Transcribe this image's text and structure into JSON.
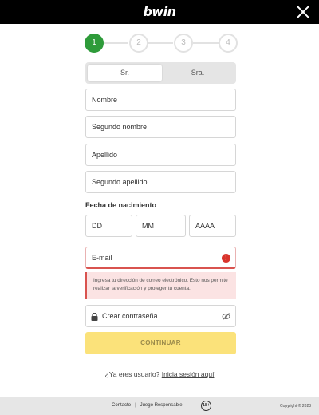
{
  "header": {
    "logo": "bwin"
  },
  "stepper": {
    "steps": [
      "1",
      "2",
      "3",
      "4"
    ],
    "active_step": 1
  },
  "title_toggle": {
    "options": [
      "Sr.",
      "Sra."
    ],
    "selected": "Sr."
  },
  "form": {
    "first_name_placeholder": "Nombre",
    "middle_name_placeholder": "Segundo nombre",
    "last_name_placeholder": "Apellido",
    "second_last_name_placeholder": "Segundo apellido",
    "birthdate_label": "Fecha de nacimiento",
    "day_placeholder": "DD",
    "month_placeholder": "MM",
    "year_placeholder": "AAAA",
    "email_placeholder": "E-mail",
    "email_error_icon": "!",
    "email_error": "Ingresa tu dirección de correo electrónico. Esto nos permite realizar la verificación y proteger tu cuenta.",
    "password_placeholder": "Crear contraseña"
  },
  "actions": {
    "continue_label": "CONTINUAR",
    "already_user_text": "¿Ya eres usuario?",
    "login_link": "Inicia sesión aquí"
  },
  "footer": {
    "contact": "Contacto",
    "separator": "|",
    "responsible": "Juego Responsable",
    "age_badge": "18+",
    "copyright": "Copyright © 2023"
  },
  "colors": {
    "accent_green": "#2e9b3a",
    "button_yellow": "#fbe27a",
    "error_red": "#d9534f"
  },
  "icons": [
    "close-icon",
    "error-icon",
    "lock-icon",
    "eye-off-icon"
  ]
}
